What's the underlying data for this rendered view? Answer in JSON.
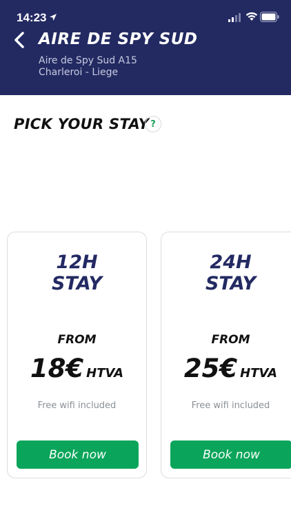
{
  "status_bar": {
    "time": "14:23",
    "icons": [
      "location-arrow-icon",
      "signal-icon",
      "wifi-icon",
      "battery-icon"
    ]
  },
  "header": {
    "title": "AIRE DE SPY SUD",
    "subtitle_line1": "Aire de Spy Sud A15",
    "subtitle_line2": "Charleroi - Liege",
    "back_icon": "chevron-left-icon"
  },
  "main": {
    "heading": "PICK YOUR STAY",
    "help_label": "?"
  },
  "cards": [
    {
      "duration": "12H",
      "stay": "STAY",
      "from": "FROM",
      "price": "18€",
      "tax": "HTVA",
      "note": "Free wifi included",
      "button": "Book now"
    },
    {
      "duration": "24H",
      "stay": "STAY",
      "from": "FROM",
      "price": "25€",
      "tax": "HTVA",
      "note": "Free wifi included",
      "button": "Book now"
    }
  ],
  "colors": {
    "header_bg": "#232a62",
    "accent_green": "#0aa55a",
    "card_title": "#232a62"
  }
}
